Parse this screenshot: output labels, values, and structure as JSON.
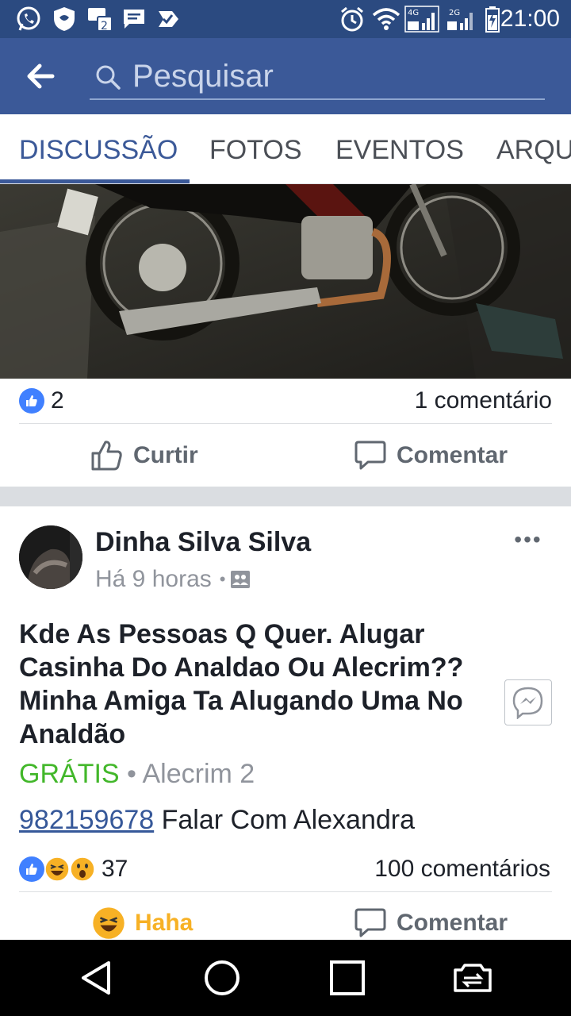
{
  "status_bar": {
    "time": "21:00",
    "icons": [
      "whatsapp-icon",
      "shield-icon",
      "sim-2-icon",
      "message-icon",
      "check-icon",
      "alarm-icon",
      "wifi-icon",
      "signal-4g-icon",
      "signal-2g-icon",
      "battery-icon"
    ],
    "network_4g": "4G",
    "network_2g": "2G"
  },
  "header": {
    "search_placeholder": "Pesquisar"
  },
  "tabs": [
    {
      "label": "DISCUSSÃO",
      "active": true
    },
    {
      "label": "FOTOS",
      "active": false
    },
    {
      "label": "EVENTOS",
      "active": false
    },
    {
      "label": "ARQU",
      "active": false
    }
  ],
  "post1": {
    "likes": "2",
    "comments": "1 comentário",
    "like_label": "Curtir",
    "comment_label": "Comentar"
  },
  "post2": {
    "author": "Dinha Silva Silva",
    "time": "Há 9 horas",
    "separator": "•",
    "text": "Kde As Pessoas Q Quer. Alugar Casinha Do Analdao Ou Alecrim?? Minha Amiga Ta Alugando Uma No Analdão",
    "price": "GRÁTIS",
    "location": "• Alecrim 2",
    "phone": "982159678",
    "contact_text": " Falar Com Alexandra",
    "reactions_count": "37",
    "comments": "100 comentários",
    "reaction_label": "Haha",
    "comment_label": "Comentar",
    "more": "•••"
  },
  "colors": {
    "facebook_blue": "#3b5998",
    "status_bar": "#2b4a80",
    "price_green": "#42b72a",
    "haha_yellow": "#f7b125",
    "like_blue": "#4080ff"
  }
}
